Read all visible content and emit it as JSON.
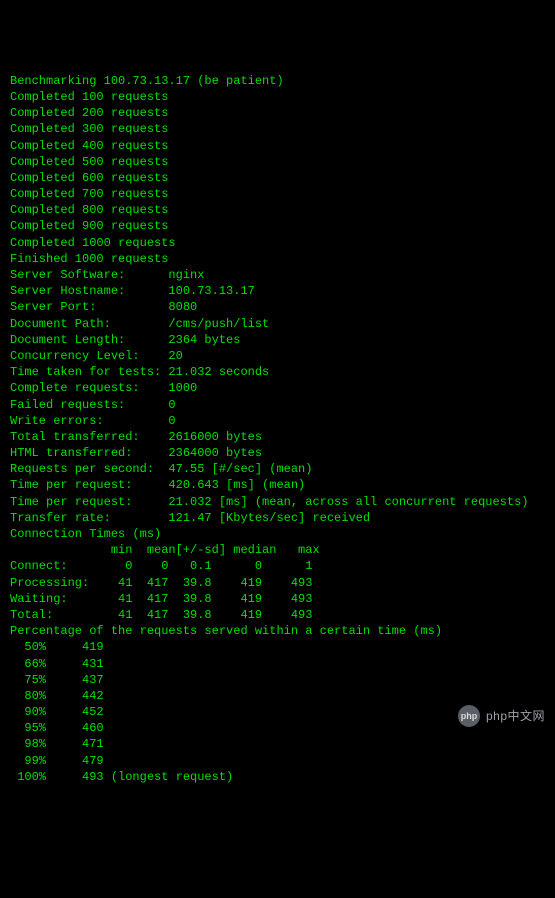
{
  "target_ip": "100.73.13.17",
  "bench_line": "Benchmarking 100.73.13.17 (be patient)",
  "progress": [
    "Completed 100 requests",
    "Completed 200 requests",
    "Completed 300 requests",
    "Completed 400 requests",
    "Completed 500 requests",
    "Completed 600 requests",
    "Completed 700 requests",
    "Completed 800 requests",
    "Completed 900 requests",
    "Completed 1000 requests",
    "Finished 1000 requests"
  ],
  "server": {
    "software_label": "Server Software:",
    "software_value": "nginx",
    "hostname_label": "Server Hostname:",
    "hostname_value": "100.73.13.17",
    "port_label": "Server Port:",
    "port_value": "8080"
  },
  "document": {
    "path_label": "Document Path:",
    "path_value": "/cms/push/list",
    "length_label": "Document Length:",
    "length_value": "2364 bytes"
  },
  "stats": {
    "concurrency_label": "Concurrency Level:",
    "concurrency_value": "20",
    "time_taken_label": "Time taken for tests:",
    "time_taken_value": "21.032 seconds",
    "complete_req_label": "Complete requests:",
    "complete_req_value": "1000",
    "failed_req_label": "Failed requests:",
    "failed_req_value": "0",
    "write_errors_label": "Write errors:",
    "write_errors_value": "0",
    "total_transferred_label": "Total transferred:",
    "total_transferred_value": "2616000 bytes",
    "html_transferred_label": "HTML transferred:",
    "html_transferred_value": "2364000 bytes",
    "rps_label": "Requests per second:",
    "rps_value": "47.55 [#/sec] (mean)",
    "tpr1_label": "Time per request:",
    "tpr1_value": "420.643 [ms] (mean)",
    "tpr2_label": "Time per request:",
    "tpr2_value": "21.032 [ms] (mean, across all concurrent requests)",
    "transfer_rate_label": "Transfer rate:",
    "transfer_rate_value": "121.47 [Kbytes/sec] received"
  },
  "conn_title": "Connection Times (ms)",
  "conn_header": "              min  mean[+/-sd] median   max",
  "conn_rows": [
    {
      "label": "Connect:",
      "min": "0",
      "mean": "0",
      "sd": "0.1",
      "median": "0",
      "max": "1"
    },
    {
      "label": "Processing:",
      "min": "41",
      "mean": "417",
      "sd": "39.8",
      "median": "419",
      "max": "493"
    },
    {
      "label": "Waiting:",
      "min": "41",
      "mean": "417",
      "sd": "39.8",
      "median": "419",
      "max": "493"
    },
    {
      "label": "Total:",
      "min": "41",
      "mean": "417",
      "sd": "39.8",
      "median": "419",
      "max": "493"
    }
  ],
  "pct_title": "Percentage of the requests served within a certain time (ms)",
  "percentiles": [
    {
      "pct": "50%",
      "val": "419"
    },
    {
      "pct": "66%",
      "val": "431"
    },
    {
      "pct": "75%",
      "val": "437"
    },
    {
      "pct": "80%",
      "val": "442"
    },
    {
      "pct": "90%",
      "val": "452"
    },
    {
      "pct": "95%",
      "val": "460"
    },
    {
      "pct": "98%",
      "val": "471"
    },
    {
      "pct": "99%",
      "val": "479"
    },
    {
      "pct": "100%",
      "val": "493",
      "suffix": " (longest request)"
    }
  ],
  "watermark": {
    "badge": "php",
    "text": "php中文网"
  },
  "chart_data": {
    "type": "table",
    "title": "ApacheBench Connection Times (ms)",
    "headers": [
      "",
      "min",
      "mean",
      "+/-sd",
      "median",
      "max"
    ],
    "rows": [
      [
        "Connect",
        0,
        0,
        0.1,
        0,
        1
      ],
      [
        "Processing",
        41,
        417,
        39.8,
        419,
        493
      ],
      [
        "Waiting",
        41,
        417,
        39.8,
        419,
        493
      ],
      [
        "Total",
        41,
        417,
        39.8,
        419,
        493
      ]
    ],
    "percentiles": {
      "50": 419,
      "66": 431,
      "75": 437,
      "80": 442,
      "90": 452,
      "95": 460,
      "98": 471,
      "99": 479,
      "100": 493
    }
  }
}
